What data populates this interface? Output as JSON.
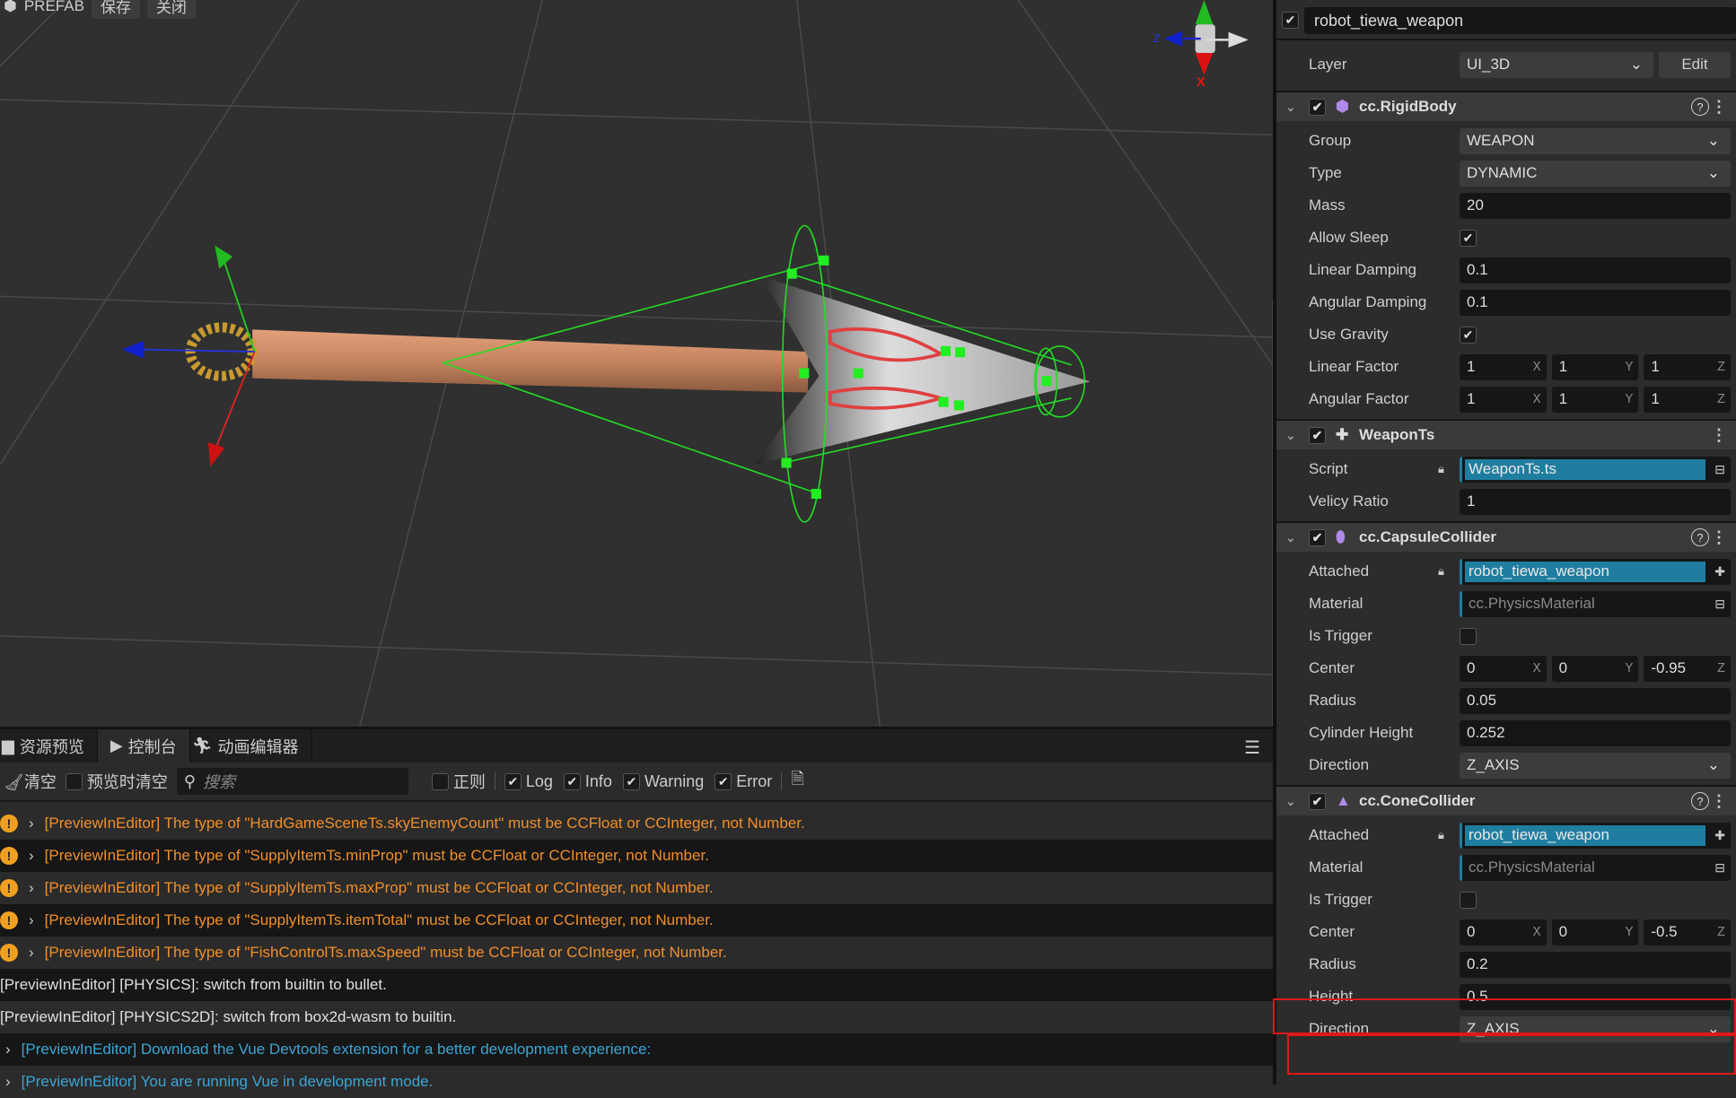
{
  "viewport": {
    "toolbar": {
      "prefab_label": "PREFAB",
      "save_label": "保存",
      "close_label": "关闭"
    },
    "gizmo_axis_label": "X",
    "gizmo_z_label": "Z"
  },
  "inspector": {
    "node_name": "robot_tiewa_weapon",
    "node_enabled": true,
    "layer": {
      "label": "Layer",
      "value": "UI_3D",
      "edit_label": "Edit"
    },
    "components": [
      {
        "title": "cc.RigidBody",
        "icon": "cube-icon",
        "icon_color": "#b08ae8",
        "help": true,
        "rows": [
          {
            "label": "Group",
            "type": "select",
            "value": "WEAPON"
          },
          {
            "label": "Type",
            "type": "select",
            "value": "DYNAMIC"
          },
          {
            "label": "Mass",
            "type": "text",
            "value": "20"
          },
          {
            "label": "Allow Sleep",
            "type": "check",
            "value": true
          },
          {
            "label": "Linear Damping",
            "type": "text",
            "value": "0.1"
          },
          {
            "label": "Angular Damping",
            "type": "text",
            "value": "0.1"
          },
          {
            "label": "Use Gravity",
            "type": "check",
            "value": true
          },
          {
            "label": "Linear Factor",
            "type": "vec",
            "value": [
              "1",
              "1",
              "1"
            ]
          },
          {
            "label": "Angular Factor",
            "type": "vec",
            "value": [
              "1",
              "1",
              "1"
            ]
          }
        ]
      },
      {
        "title": "WeaponTs",
        "icon": "puzzle-icon",
        "icon_color": "#dddddd",
        "help": false,
        "rows": [
          {
            "label": "Script",
            "type": "asset",
            "value": "WeaponTs.ts",
            "locked": true,
            "asset_icon": "inbox-icon"
          },
          {
            "label": "Velicy Ratio",
            "type": "text",
            "value": "1"
          }
        ]
      },
      {
        "title": "cc.CapsuleCollider",
        "icon": "capsule-icon",
        "icon_color": "#b08ae8",
        "help": true,
        "rows": [
          {
            "label": "Attached",
            "type": "asset",
            "value": "robot_tiewa_weapon",
            "locked": true,
            "asset_icon": "puzzle-icon"
          },
          {
            "label": "Material",
            "type": "asset",
            "value": "cc.PhysicsMaterial",
            "empty": true,
            "asset_icon": "inbox-icon"
          },
          {
            "label": "Is Trigger",
            "type": "check",
            "value": false
          },
          {
            "label": "Center",
            "type": "vec",
            "value": [
              "0",
              "0",
              "-0.95"
            ]
          },
          {
            "label": "Radius",
            "type": "text",
            "value": "0.05"
          },
          {
            "label": "Cylinder Height",
            "type": "text",
            "value": "0.252"
          },
          {
            "label": "Direction",
            "type": "select",
            "value": "Z_AXIS"
          }
        ]
      },
      {
        "title": "cc.ConeCollider",
        "icon": "cone-icon",
        "icon_color": "#b08ae8",
        "help": true,
        "rows": [
          {
            "label": "Attached",
            "type": "asset",
            "value": "robot_tiewa_weapon",
            "locked": true,
            "asset_icon": "puzzle-icon"
          },
          {
            "label": "Material",
            "type": "asset",
            "value": "cc.PhysicsMaterial",
            "empty": true,
            "asset_icon": "inbox-icon"
          },
          {
            "label": "Is Trigger",
            "type": "check",
            "value": false
          },
          {
            "label": "Center",
            "type": "vec",
            "value": [
              "0",
              "0",
              "-0.5"
            ]
          },
          {
            "label": "Radius",
            "type": "text",
            "value": "0.2"
          },
          {
            "label": "Height",
            "type": "text",
            "value": "0.5",
            "highlighted": true
          },
          {
            "label": "Direction",
            "type": "select",
            "value": "Z_AXIS",
            "highlighted": true
          }
        ]
      }
    ],
    "axis_labels": [
      "X",
      "Y",
      "Z"
    ]
  },
  "console": {
    "tabs": [
      {
        "label": "资源预览",
        "icon": "folder-icon"
      },
      {
        "label": "控制台",
        "icon": "terminal-icon",
        "active": true
      },
      {
        "label": "动画编辑器",
        "icon": "running-icon"
      }
    ],
    "toolbar": {
      "clear_label": "清空",
      "clear_on_preview_label": "预览时清空",
      "clear_on_preview": false,
      "search_placeholder": "搜索",
      "regex_label": "正则",
      "regex": false,
      "filters": [
        {
          "label": "Log",
          "checked": true
        },
        {
          "label": "Info",
          "checked": true
        },
        {
          "label": "Warning",
          "checked": true
        },
        {
          "label": "Error",
          "checked": true
        }
      ]
    },
    "logs": [
      {
        "level": "warn",
        "text": "[PreviewInEditor] The type of \"HardGameSceneTs.skyEnemyCount\" must be CCFloat or CCInteger, not Number."
      },
      {
        "level": "warn",
        "text": "[PreviewInEditor] The type of \"SupplyItemTs.minProp\" must be CCFloat or CCInteger, not Number."
      },
      {
        "level": "warn",
        "text": "[PreviewInEditor] The type of \"SupplyItemTs.maxProp\" must be CCFloat or CCInteger, not Number."
      },
      {
        "level": "warn",
        "text": "[PreviewInEditor] The type of \"SupplyItemTs.itemTotal\" must be CCFloat or CCInteger, not Number."
      },
      {
        "level": "warn",
        "text": "[PreviewInEditor] The type of \"FishControlTs.maxSpeed\" must be CCFloat or CCInteger, not Number."
      },
      {
        "level": "plain",
        "text": "[PreviewInEditor] [PHYSICS]: switch from builtin to bullet."
      },
      {
        "level": "plain",
        "text": "[PreviewInEditor] [PHYSICS2D]: switch from box2d-wasm to builtin."
      },
      {
        "level": "info",
        "text": "[PreviewInEditor] Download the Vue Devtools extension for a better development experience:"
      },
      {
        "level": "info",
        "text": "[PreviewInEditor] You are running Vue in development mode."
      }
    ]
  },
  "colors": {
    "warning": "#f08f2a",
    "info": "#3aa6d6",
    "highlight": "#e01818",
    "asset": "#1f7ea0"
  }
}
